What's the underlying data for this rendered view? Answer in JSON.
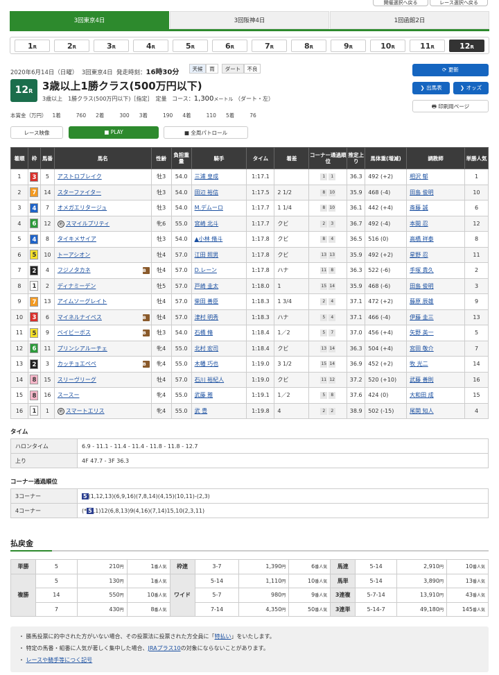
{
  "top_buttons": [
    "開催選択へ戻る",
    "レース選択へ戻る"
  ],
  "venues": [
    {
      "label": "3回東京4日",
      "active": true
    },
    {
      "label": "3回阪神4日",
      "active": false
    },
    {
      "label": "1回函館2日",
      "active": false
    }
  ],
  "race_suffix": "R",
  "races": [
    "1",
    "2",
    "3",
    "4",
    "5",
    "6",
    "7",
    "8",
    "9",
    "10",
    "11",
    "12"
  ],
  "active_race": "12",
  "info": {
    "date": "2020年6月14日（日曜）",
    "meeting": "3回東京4日",
    "start_label": "発走時刻：",
    "start_time": "16時30分",
    "weather_label": "天候",
    "weather_value": "雨",
    "track_label": "ダート",
    "track_value": "不良"
  },
  "race": {
    "number": "12",
    "suffix": "R",
    "title": "3歳以上1勝クラス(500万円以下)",
    "sub": "3歳以上　1勝クラス(500万円以下)［指定］　定量",
    "course_label": "コース：",
    "distance": "1,300",
    "unit": "メートル",
    "surface": "（ダート・左）"
  },
  "prize": {
    "label": "本賞金（万円）",
    "items": [
      {
        "rank": "1着",
        "amount": "760"
      },
      {
        "rank": "2着",
        "amount": "300"
      },
      {
        "rank": "3着",
        "amount": "190"
      },
      {
        "rank": "4着",
        "amount": "110"
      },
      {
        "rank": "5着",
        "amount": "76"
      }
    ]
  },
  "buttons": {
    "refresh": "更新",
    "starters": "出馬表",
    "odds": "オッズ",
    "print": "印刷用ページ",
    "video": "レース映像",
    "play": "PLAY",
    "patrol": "全周パトロール"
  },
  "colors": {
    "green": "#2d8a2d",
    "blue": "#1565c0",
    "dark": "#3b3b3b"
  },
  "results_headers": [
    "着順",
    "枠",
    "馬番",
    "馬名",
    "性齢",
    "負担重量",
    "騎手",
    "タイム",
    "着差",
    "コーナー通過順位",
    "推定上り",
    "馬体重(増減)",
    "調教師",
    "単勝人気"
  ],
  "results": [
    {
      "pos": "1",
      "waku": "3",
      "num": "5",
      "name": "アストロブレイク",
      "mark": "",
      "sex": "牡3",
      "wt": "54.0",
      "jockey": "三浦 皇成",
      "time": "1:17.1",
      "margin": "",
      "c3": "1",
      "c4": "1",
      "up": "36.3",
      "body": "492 (+2)",
      "trainer": "相沢 郁",
      "pop": "1"
    },
    {
      "pos": "2",
      "waku": "7",
      "num": "14",
      "name": "スターファイター",
      "mark": "",
      "sex": "牡3",
      "wt": "54.0",
      "jockey": "田辺 裕信",
      "time": "1:17.5",
      "margin": "2 1/2",
      "c3": "8",
      "c4": "10",
      "up": "35.9",
      "body": "468 (-4)",
      "trainer": "田島 俊明",
      "pop": "10"
    },
    {
      "pos": "3",
      "waku": "4",
      "num": "7",
      "name": "オメガエリタージュ",
      "mark": "",
      "sex": "牡3",
      "wt": "54.0",
      "jockey": "M.デムーロ",
      "time": "1:17.7",
      "margin": "1 1/4",
      "c3": "8",
      "c4": "10",
      "up": "36.1",
      "body": "442 (+4)",
      "trainer": "斎藤 誠",
      "pop": "6"
    },
    {
      "pos": "4",
      "waku": "6",
      "num": "12",
      "name": "スマイルプリティ",
      "mark": "地",
      "sex": "牝6",
      "wt": "55.0",
      "jockey": "宮崎 北斗",
      "time": "1:17.7",
      "margin": "クビ",
      "c3": "2",
      "c4": "3",
      "up": "36.7",
      "body": "492 (-4)",
      "trainer": "本間 忍",
      "pop": "12"
    },
    {
      "pos": "5",
      "waku": "4",
      "num": "8",
      "name": "タイキメサイア",
      "mark": "",
      "sex": "牡3",
      "wt": "54.0",
      "jockey": "▲小林 脩斗",
      "time": "1:17.8",
      "margin": "クビ",
      "c3": "8",
      "c4": "4",
      "up": "36.5",
      "body": "516 (0)",
      "trainer": "高橋 祥泰",
      "pop": "8"
    },
    {
      "pos": "6",
      "waku": "5",
      "num": "10",
      "name": "トーアシオン",
      "mark": "",
      "sex": "牡4",
      "wt": "57.0",
      "jockey": "江田 照男",
      "time": "1:17.8",
      "margin": "クビ",
      "c3": "13",
      "c4": "13",
      "up": "35.9",
      "body": "492 (+2)",
      "trainer": "星野 忍",
      "pop": "11"
    },
    {
      "pos": "7",
      "waku": "2",
      "num": "4",
      "name": "フジノタカネ",
      "mark": "B",
      "sex": "牡4",
      "wt": "57.0",
      "jockey": "D.レーン",
      "time": "1:17.8",
      "margin": "ハナ",
      "c3": "11",
      "c4": "8",
      "up": "36.3",
      "body": "522 (-6)",
      "trainer": "手塚 貴久",
      "pop": "2"
    },
    {
      "pos": "8",
      "waku": "1",
      "num": "2",
      "name": "ディナミーデン",
      "mark": "",
      "sex": "牡5",
      "wt": "57.0",
      "jockey": "戸崎 圭太",
      "time": "1:18.0",
      "margin": "1",
      "c3": "15",
      "c4": "14",
      "up": "35.9",
      "body": "468 (-6)",
      "trainer": "田島 俊明",
      "pop": "3"
    },
    {
      "pos": "9",
      "waku": "7",
      "num": "13",
      "name": "アイムソーグレイト",
      "mark": "",
      "sex": "牡4",
      "wt": "57.0",
      "jockey": "柴田 善臣",
      "time": "1:18.3",
      "margin": "1 3/4",
      "c3": "2",
      "c4": "4",
      "up": "37.1",
      "body": "472 (+2)",
      "trainer": "藤原 辰雄",
      "pop": "9"
    },
    {
      "pos": "10",
      "waku": "3",
      "num": "6",
      "name": "マイネルナイペス",
      "mark": "B",
      "sex": "牡4",
      "wt": "57.0",
      "jockey": "津村 明秀",
      "time": "1:18.3",
      "margin": "ハナ",
      "c3": "5",
      "c4": "4",
      "up": "37.1",
      "body": "466 (-4)",
      "trainer": "伊藤 圭三",
      "pop": "13"
    },
    {
      "pos": "11",
      "waku": "5",
      "num": "9",
      "name": "ベイビーボス",
      "mark": "B",
      "sex": "牡3",
      "wt": "54.0",
      "jockey": "石橋 脩",
      "time": "1:18.4",
      "margin": "1／2",
      "c3": "5",
      "c4": "7",
      "up": "37.0",
      "body": "456 (+4)",
      "trainer": "矢野 英一",
      "pop": "5"
    },
    {
      "pos": "12",
      "waku": "6",
      "num": "11",
      "name": "プリンシアルーチェ",
      "mark": "",
      "sex": "牝4",
      "wt": "55.0",
      "jockey": "北村 宏司",
      "time": "1:18.4",
      "margin": "クビ",
      "c3": "13",
      "c4": "14",
      "up": "36.3",
      "body": "504 (+4)",
      "trainer": "宮田 敬介",
      "pop": "7"
    },
    {
      "pos": "13",
      "waku": "2",
      "num": "3",
      "name": "カッチョエペペ",
      "mark": "B",
      "sex": "牝4",
      "wt": "55.0",
      "jockey": "木幡 巧也",
      "time": "1:19.0",
      "margin": "3 1/2",
      "c3": "15",
      "c4": "14",
      "up": "36.9",
      "body": "452 (+2)",
      "trainer": "牧 光二",
      "pop": "14"
    },
    {
      "pos": "14",
      "waku": "8",
      "num": "15",
      "name": "スリーヴリーグ",
      "mark": "",
      "sex": "牡4",
      "wt": "57.0",
      "jockey": "石川 裕紀人",
      "time": "1:19.0",
      "margin": "クビ",
      "c3": "11",
      "c4": "12",
      "up": "37.2",
      "body": "520 (+10)",
      "trainer": "武藤 善則",
      "pop": "16"
    },
    {
      "pos": "15",
      "waku": "8",
      "num": "16",
      "name": "スースー",
      "mark": "",
      "sex": "牝4",
      "wt": "55.0",
      "jockey": "武藤 雅",
      "time": "1:19.1",
      "margin": "1／2",
      "c3": "5",
      "c4": "8",
      "up": "37.6",
      "body": "424 (0)",
      "trainer": "大和田 成",
      "pop": "15"
    },
    {
      "pos": "16",
      "waku": "1",
      "num": "1",
      "name": "スマートエリス",
      "mark": "地",
      "sex": "牝4",
      "wt": "55.0",
      "jockey": "武 豊",
      "time": "1:19.8",
      "margin": "4",
      "c3": "2",
      "c4": "2",
      "up": "38.9",
      "body": "502 (-15)",
      "trainer": "尾関 知人",
      "pop": "4"
    }
  ],
  "time_section": {
    "title": "タイム",
    "rows": [
      {
        "label": "ハロンタイム",
        "value": "6.9 - 11.1 - 11.4 - 11.4 - 11.8 - 11.8 - 12.7"
      },
      {
        "label": "上り",
        "value": "4F 47.7 - 3F 36.3"
      }
    ]
  },
  "corner_section": {
    "title": "コーナー通過順位",
    "rows": [
      {
        "label": "3コーナー",
        "prefix": "",
        "lead": "5",
        "rest": "(1,12,13)(6,9,16)(7,8,14)(4,15)(10,11)-(2,3)"
      },
      {
        "label": "4コーナー",
        "prefix": "(*",
        "lead": "5",
        "rest": ",1)12(6,8,13)9(4,16)(7,14)15,10(2,3,11)"
      }
    ]
  },
  "payout": {
    "title": "払戻金",
    "pop_suffix": "番人気",
    "yen": "円",
    "left": [
      {
        "type": "単勝",
        "combo": "5",
        "amount": "210",
        "pop": "1"
      },
      {
        "type": "複勝",
        "combo": "5",
        "amount": "130",
        "pop": "1"
      },
      {
        "type": "",
        "combo": "14",
        "amount": "550",
        "pop": "10"
      },
      {
        "type": "",
        "combo": "7",
        "amount": "430",
        "pop": "8"
      }
    ],
    "middle": [
      {
        "type": "枠連",
        "combo": "3-7",
        "amount": "1,390",
        "pop": "6"
      },
      {
        "type": "ワイド",
        "combo": "5-14",
        "amount": "1,110",
        "pop": "10"
      },
      {
        "type": "",
        "combo": "5-7",
        "amount": "980",
        "pop": "9"
      },
      {
        "type": "",
        "combo": "7-14",
        "amount": "4,350",
        "pop": "50"
      }
    ],
    "right": [
      {
        "type": "馬連",
        "combo": "5-14",
        "amount": "2,910",
        "pop": "10"
      },
      {
        "type": "馬単",
        "combo": "5-14",
        "amount": "3,890",
        "pop": "13"
      },
      {
        "type": "3連複",
        "combo": "5-7-14",
        "amount": "13,910",
        "pop": "43"
      },
      {
        "type": "3連単",
        "combo": "5-14-7",
        "amount": "49,180",
        "pop": "145"
      }
    ]
  },
  "notes": {
    "n1_pre": "勝馬投票に的中された方がいない場合、その投票法に投票された方全員に「",
    "n1_link": "特払い",
    "n1_post": "」をいたします。",
    "n2_pre": "特定の馬番・組番に人気が著しく集中した場合、",
    "n2_link": "JRAプラス10",
    "n2_post": "の対象にならないことがあります。",
    "n3_link": "レースや騎手等につく記号"
  }
}
